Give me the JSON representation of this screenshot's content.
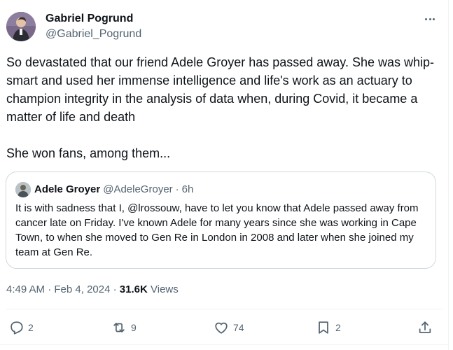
{
  "author": {
    "name": "Gabriel Pogrund",
    "handle": "@Gabriel_Pogrund",
    "avatar_icon": "avatar-photo"
  },
  "tweet": {
    "text": "So devastated that our friend Adele Groyer has passed away.  She was whip-smart and used her immense intelligence and life's work as an actuary to champion integrity in the analysis of data when, during Covid, it became a matter of life and death\n\nShe won fans, among them..."
  },
  "quote": {
    "name": "Adele Groyer",
    "handle": "@AdeleGroyer",
    "separator": "·",
    "time": "6h",
    "text": "It is with sadness that I, @lrossouw, have to let you know that Adele passed away from cancer late on Friday.    I've known Adele for many years since she was working in Cape Town, to when she moved to Gen Re in London in 2008 and later when she joined my team at Gen Re."
  },
  "meta": {
    "time": "4:49 AM",
    "sep1": "·",
    "date": "Feb 4, 2024",
    "sep2": "·",
    "views_count": "31.6K",
    "views_label": "Views"
  },
  "actions": {
    "replies": "2",
    "reposts": "9",
    "likes": "74",
    "bookmarks": "2"
  },
  "icons": [
    "more-icon",
    "reply-icon",
    "repost-icon",
    "like-icon",
    "bookmark-icon",
    "share-icon"
  ],
  "colors": {
    "text": "#0f1419",
    "secondary": "#536471",
    "border": "#cfd9de"
  }
}
